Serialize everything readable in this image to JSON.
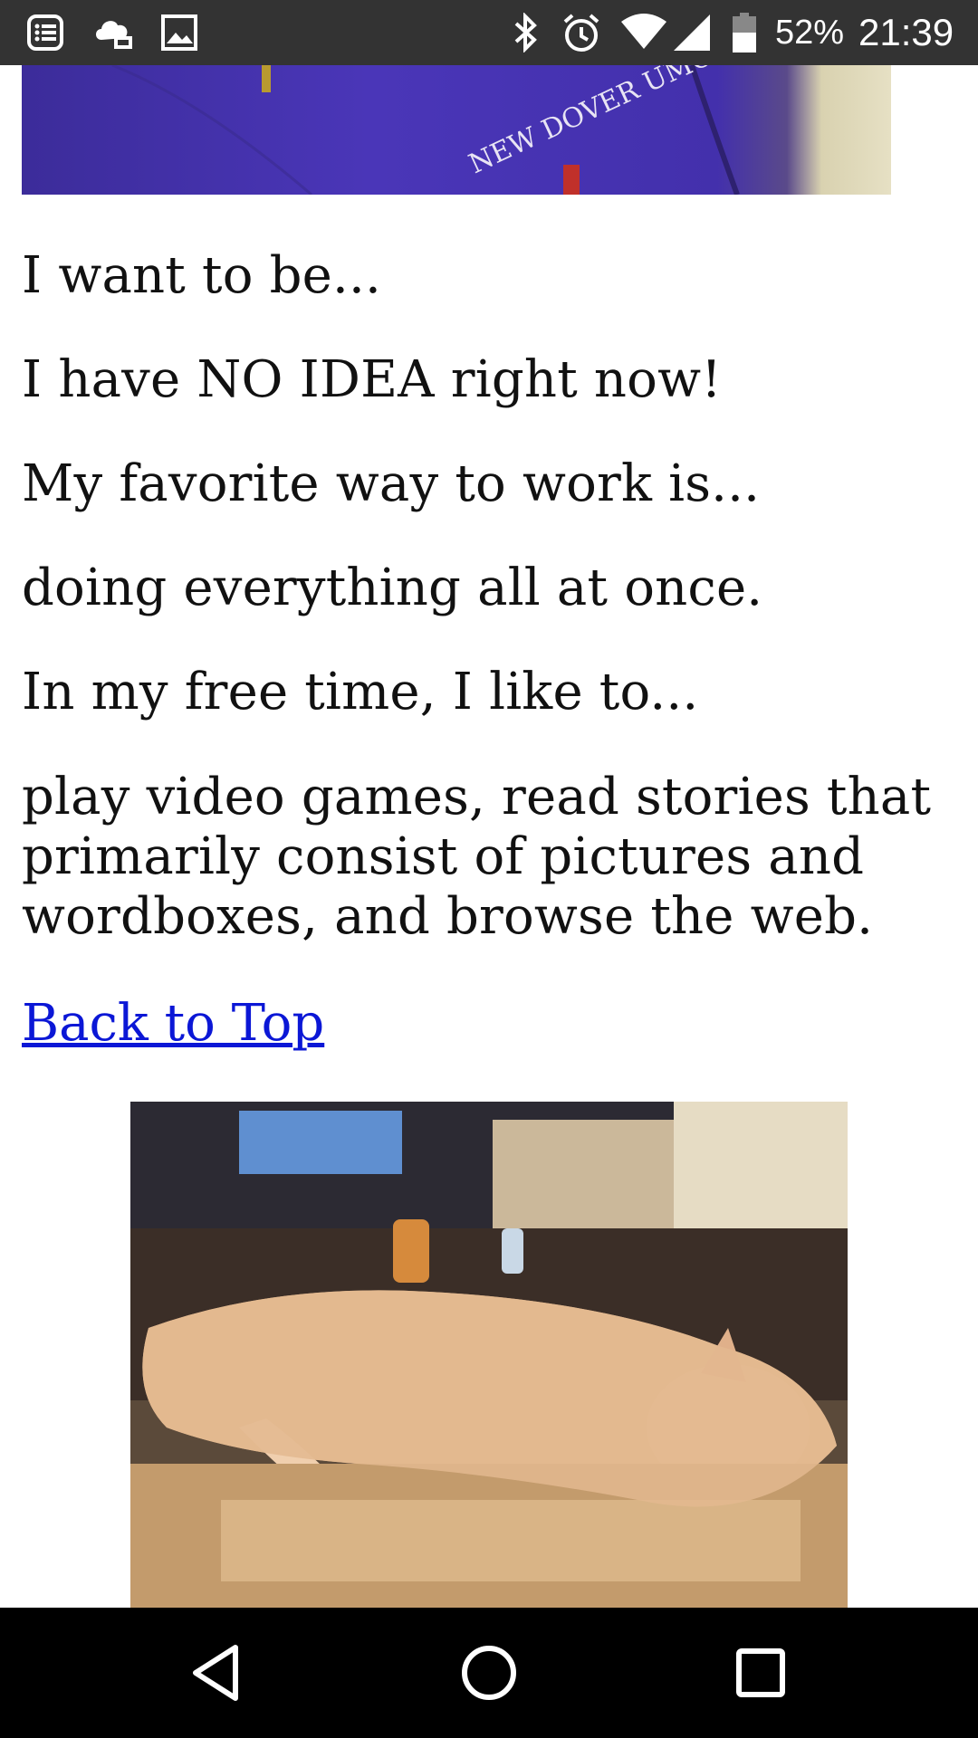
{
  "status_bar": {
    "icons_left": [
      "task-list-icon",
      "cloud-upload-icon",
      "image-icon"
    ],
    "icons_right": [
      "bluetooth-icon",
      "alarm-icon",
      "wifi-icon",
      "cellular-signal-icon",
      "battery-icon"
    ],
    "battery_percent": "52%",
    "time": "21:39"
  },
  "content": {
    "prompt_want_to_be": "I want to be...",
    "answer_want_to_be": "I have NO IDEA right now!",
    "prompt_work": "My favorite way to work is...",
    "answer_work": "doing everything all at once.",
    "prompt_free_time": "In my free time, I like to...",
    "answer_free_time_line1": "play video games, read stories that",
    "answer_free_time_line2": "primarily consist of pictures and",
    "answer_free_time_line3": "wordboxes, and browse the web.",
    "back_to_top": "Back to Top",
    "shirt_text": "NEW DOVER UMC"
  },
  "nav_bar": {
    "buttons": [
      "back-icon",
      "home-icon",
      "recents-icon"
    ]
  },
  "colors": {
    "status_bar_bg": "#333333",
    "nav_bar_bg": "#000000",
    "link": "#0b17d6",
    "text": "#111111"
  }
}
